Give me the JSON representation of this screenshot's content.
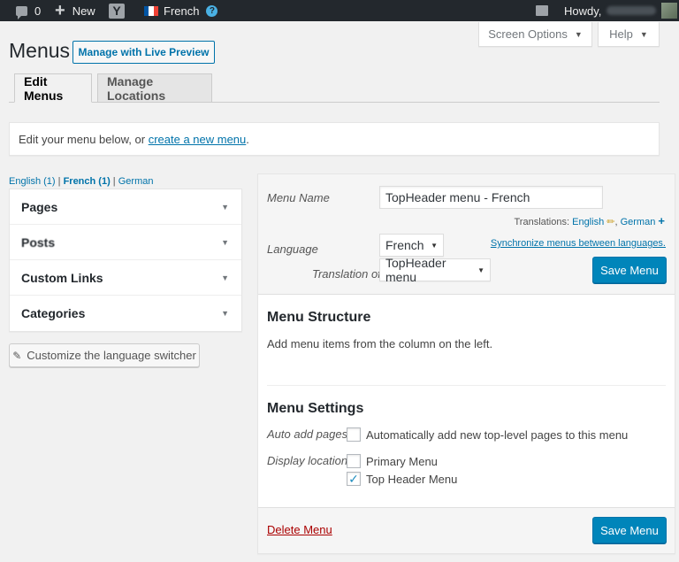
{
  "admin_bar": {
    "comments_count": "0",
    "new_label": "New",
    "yoast_glyph": "Y",
    "language_label": "French",
    "help_glyph": "?",
    "howdy_label": "Howdy,",
    "flag_colors": [
      "#0055a4",
      "#ffffff",
      "#ef4135"
    ]
  },
  "screen_options": {
    "label": "Screen Options",
    "caret": "▼"
  },
  "help_tab": {
    "label": "Help",
    "caret": "▼"
  },
  "page": {
    "title": "Menus",
    "live_preview_label": "Manage with Live Preview"
  },
  "tabs": [
    {
      "label": "Edit Menus",
      "active": true
    },
    {
      "label": "Manage Locations",
      "active": false
    }
  ],
  "notice": {
    "prefix": "Edit your menu below, or ",
    "link": "create a new menu",
    "suffix": "."
  },
  "language_filter": {
    "english": "English (1)",
    "sep1": " | ",
    "french": "French (1)",
    "sep2": " | ",
    "german": "German"
  },
  "accordion": [
    {
      "label": "Pages"
    },
    {
      "label": "Posts"
    },
    {
      "label": "Custom Links"
    },
    {
      "label": "Categories"
    }
  ],
  "customize_switcher_label": "Customize the language switcher",
  "menu_editor": {
    "menu_name_label": "Menu Name",
    "menu_name_value": "TopHeader menu - French",
    "translations_label": "Translations:",
    "translation_english": "English",
    "translation_separator": ",",
    "translation_german": "German",
    "language_label": "Language",
    "language_value": "French",
    "sync_link": "Synchronize menus between languages.",
    "translation_of_label": "Translation of",
    "translation_of_value": "TopHeader menu",
    "save_label": "Save Menu"
  },
  "menu_structure": {
    "title": "Menu Structure",
    "help_text": "Add menu items from the column on the left."
  },
  "menu_settings": {
    "title": "Menu Settings",
    "auto_add_label": "Auto add pages",
    "auto_add_option": "Automatically add new top-level pages to this menu",
    "auto_add_checked": false,
    "display_location_label": "Display location",
    "locations": [
      {
        "label": "Primary Menu",
        "checked": false
      },
      {
        "label": "Top Header Menu",
        "checked": true
      }
    ]
  },
  "footer": {
    "delete_label": "Delete Menu",
    "save_label": "Save Menu"
  },
  "colors": {
    "admin_bar": "#23282d",
    "primary": "#0085ba",
    "link": "#0073aa",
    "delete": "#a00"
  }
}
